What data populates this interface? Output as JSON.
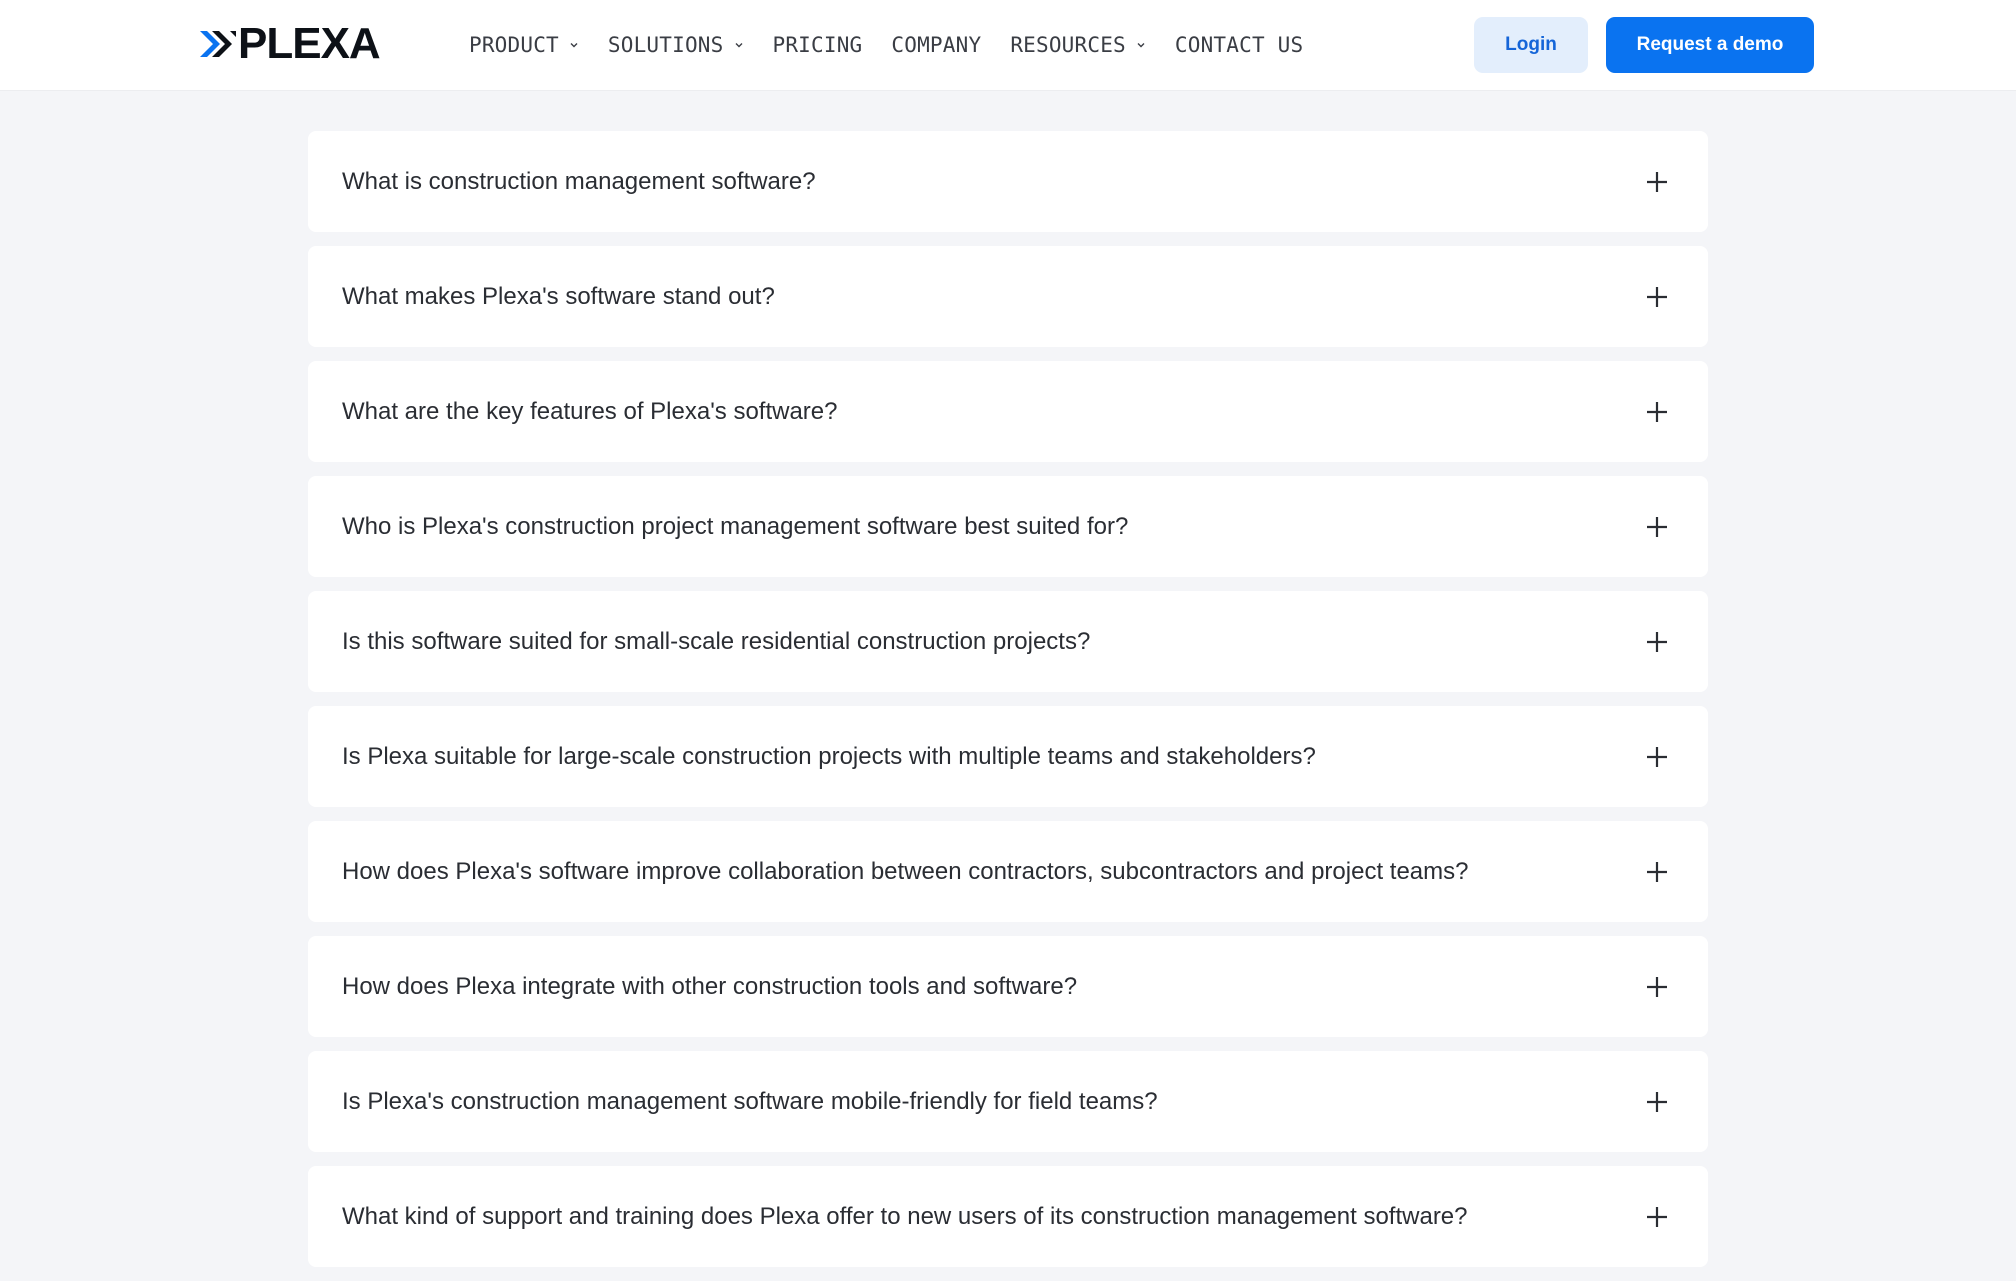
{
  "brand": {
    "name": "PLEXA",
    "accent": "#0a73f0",
    "dark": "#0d1117"
  },
  "nav": {
    "items": [
      {
        "label": "PRODUCT",
        "dropdown": true
      },
      {
        "label": "SOLUTIONS",
        "dropdown": true
      },
      {
        "label": "PRICING",
        "dropdown": false
      },
      {
        "label": "COMPANY",
        "dropdown": false
      },
      {
        "label": "RESOURCES",
        "dropdown": true
      },
      {
        "label": "CONTACT US",
        "dropdown": false
      }
    ],
    "login_label": "Login",
    "demo_label": "Request a demo"
  },
  "faq": {
    "expand_icon": "plus-icon",
    "items": [
      {
        "question": "What is construction management software?"
      },
      {
        "question": "What makes Plexa's software stand out?"
      },
      {
        "question": "What are the key features of Plexa's software?"
      },
      {
        "question": "Who is Plexa's construction project management software best suited for?"
      },
      {
        "question": "Is this software suited for small-scale residential construction projects?"
      },
      {
        "question": "Is Plexa suitable for large-scale construction projects with multiple teams and stakeholders?"
      },
      {
        "question": "How does Plexa's software improve collaboration between contractors, subcontractors and project teams?"
      },
      {
        "question": "How does Plexa integrate with other construction tools and software?"
      },
      {
        "question": "Is Plexa's construction management software mobile-friendly for field teams?"
      },
      {
        "question": "What kind of support and training does Plexa offer to new users of its construction management software?"
      }
    ]
  }
}
